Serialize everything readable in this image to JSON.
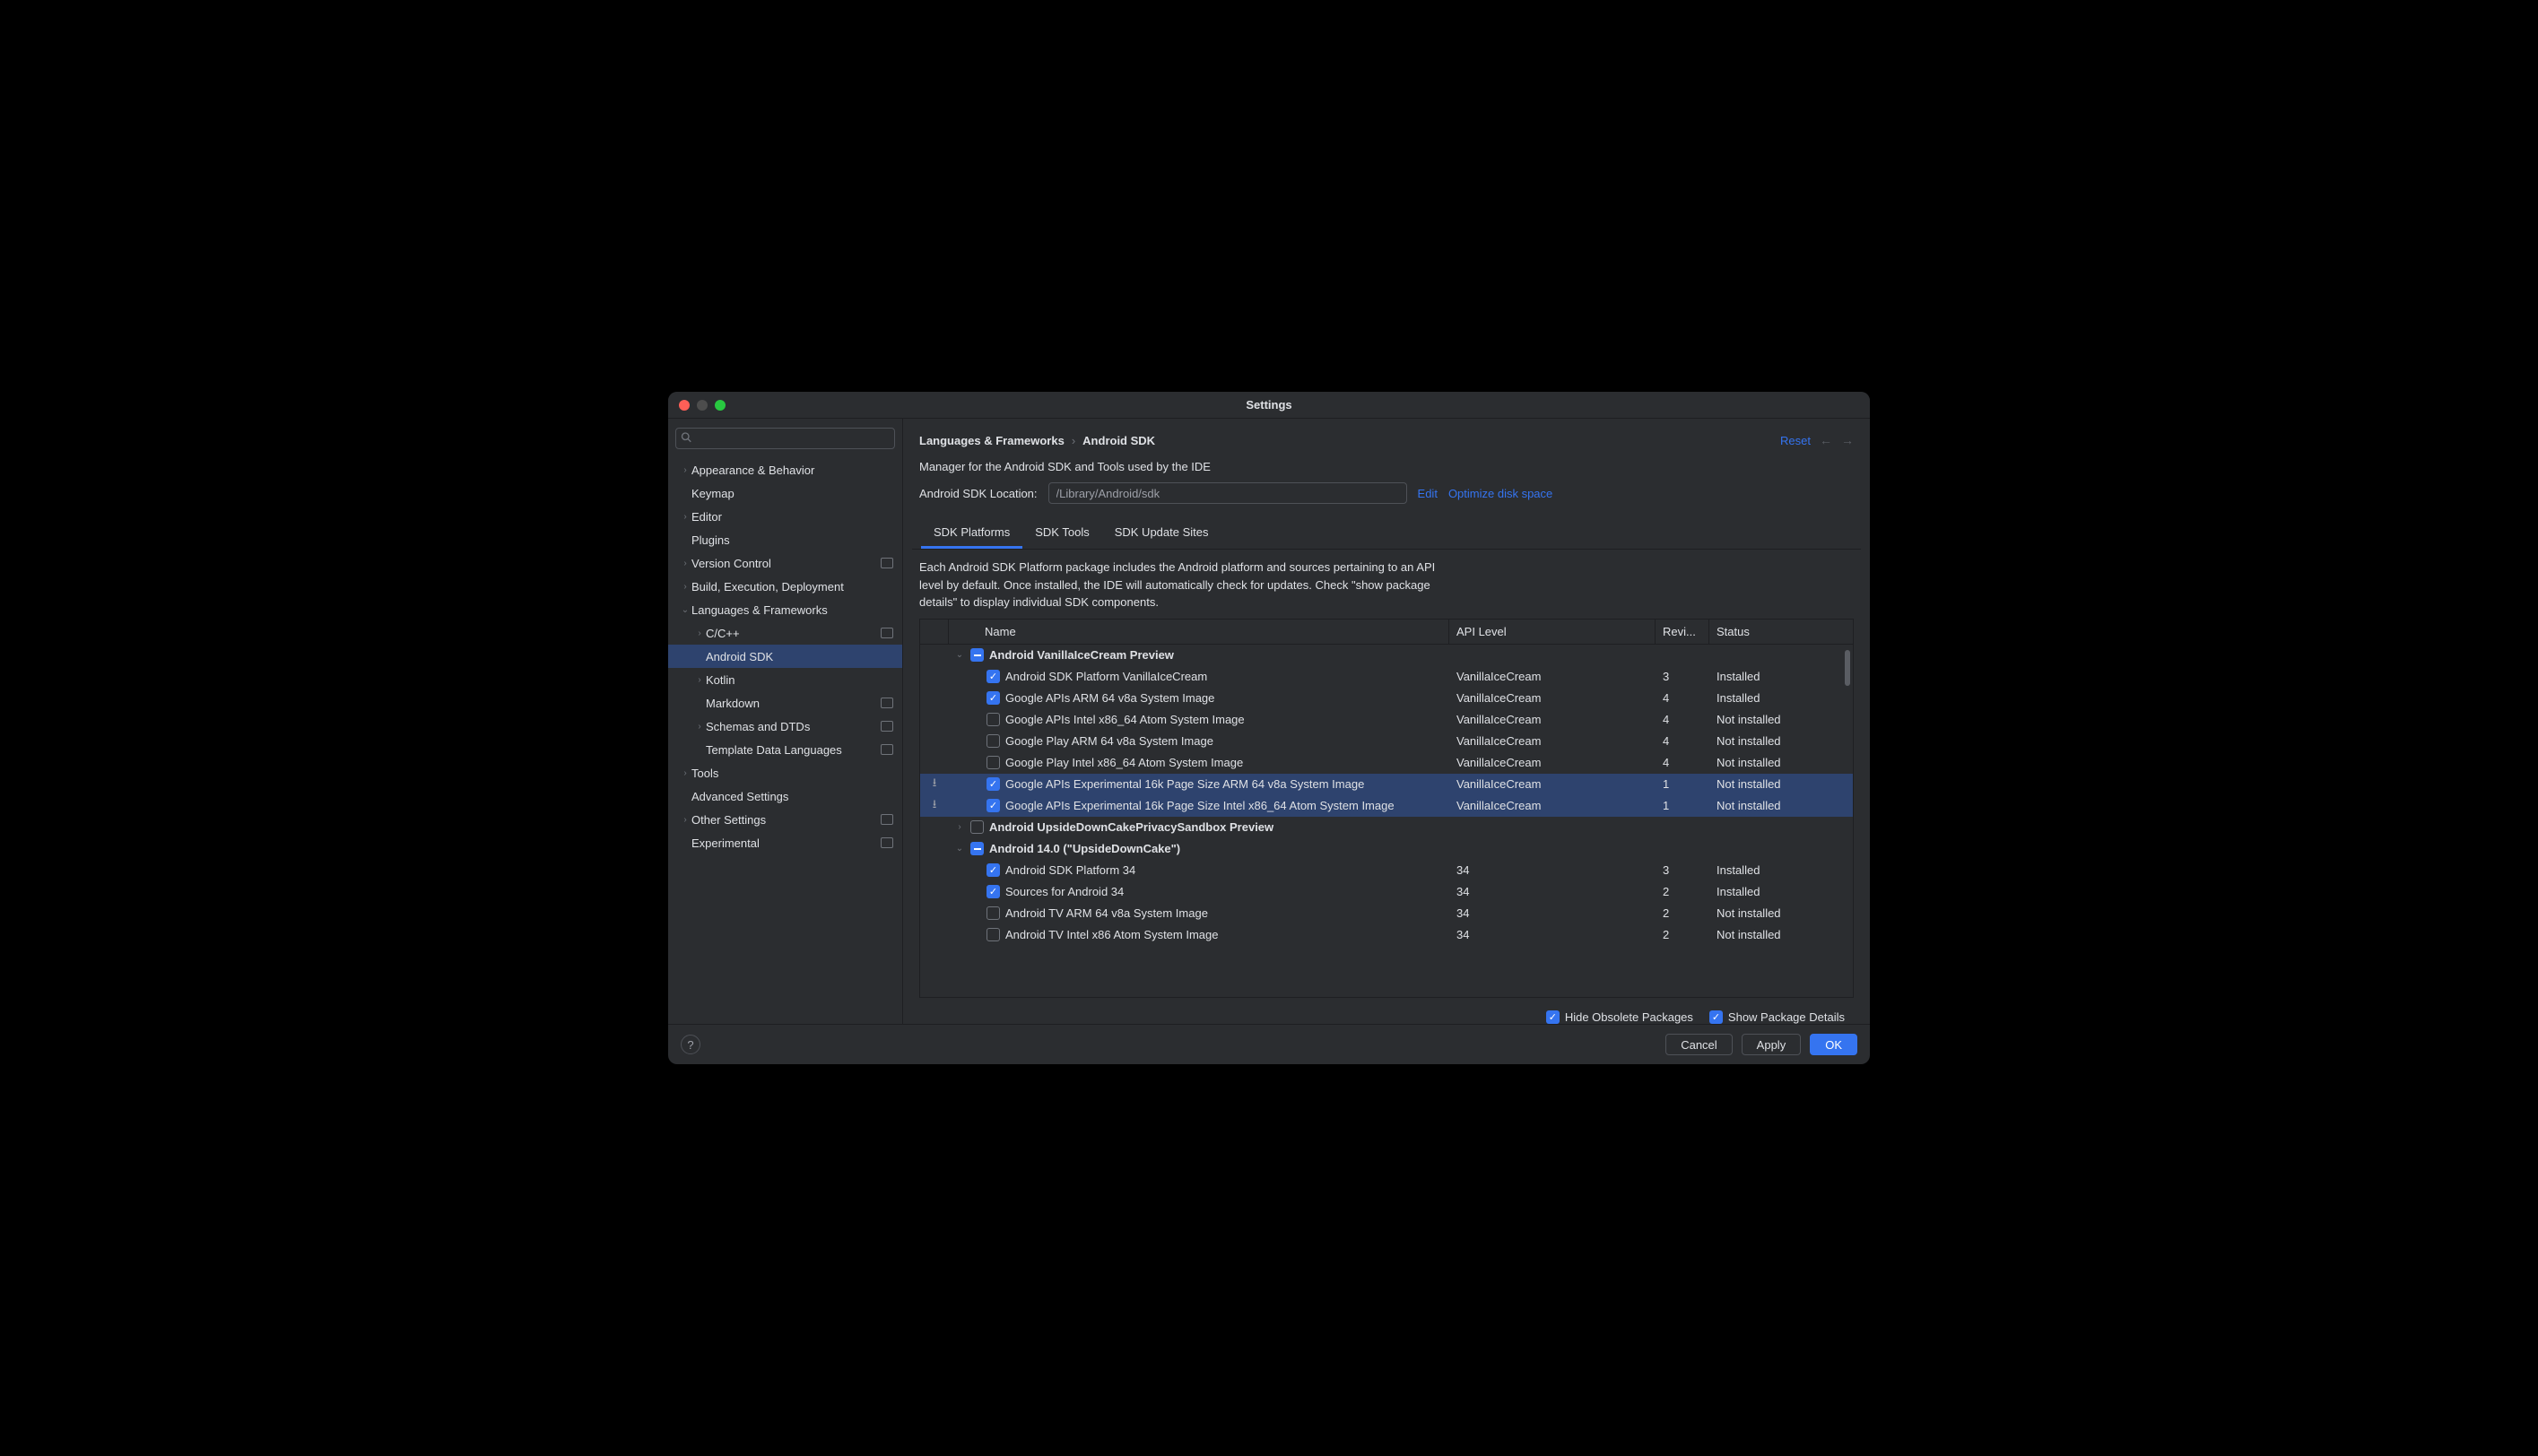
{
  "window": {
    "title": "Settings"
  },
  "search": {
    "placeholder": ""
  },
  "sidebar": {
    "items": [
      {
        "label": "Appearance & Behavior",
        "arrow": "right",
        "indent": 0,
        "badge": false
      },
      {
        "label": "Keymap",
        "arrow": "",
        "indent": 0,
        "badge": false
      },
      {
        "label": "Editor",
        "arrow": "right",
        "indent": 0,
        "badge": false
      },
      {
        "label": "Plugins",
        "arrow": "",
        "indent": 0,
        "badge": false
      },
      {
        "label": "Version Control",
        "arrow": "right",
        "indent": 0,
        "badge": true
      },
      {
        "label": "Build, Execution, Deployment",
        "arrow": "right",
        "indent": 0,
        "badge": false
      },
      {
        "label": "Languages & Frameworks",
        "arrow": "down",
        "indent": 0,
        "badge": false
      },
      {
        "label": "C/C++",
        "arrow": "right",
        "indent": 1,
        "badge": true
      },
      {
        "label": "Android SDK",
        "arrow": "",
        "indent": 1,
        "badge": false,
        "selected": true
      },
      {
        "label": "Kotlin",
        "arrow": "right",
        "indent": 1,
        "badge": false
      },
      {
        "label": "Markdown",
        "arrow": "",
        "indent": 1,
        "badge": true
      },
      {
        "label": "Schemas and DTDs",
        "arrow": "right",
        "indent": 1,
        "badge": true
      },
      {
        "label": "Template Data Languages",
        "arrow": "",
        "indent": 1,
        "badge": true
      },
      {
        "label": "Tools",
        "arrow": "right",
        "indent": 0,
        "badge": false
      },
      {
        "label": "Advanced Settings",
        "arrow": "",
        "indent": 0,
        "badge": false
      },
      {
        "label": "Other Settings",
        "arrow": "right",
        "indent": 0,
        "badge": true
      },
      {
        "label": "Experimental",
        "arrow": "",
        "indent": 0,
        "badge": true
      }
    ]
  },
  "breadcrumb": {
    "parent": "Languages & Frameworks",
    "current": "Android SDK"
  },
  "reset": "Reset",
  "subtitle": "Manager for the Android SDK and Tools used by the IDE",
  "location": {
    "label": "Android SDK Location:",
    "value": "/Library/Android/sdk",
    "edit": "Edit",
    "optimize": "Optimize disk space"
  },
  "tabs": [
    {
      "label": "SDK Platforms",
      "active": true
    },
    {
      "label": "SDK Tools",
      "active": false
    },
    {
      "label": "SDK Update Sites",
      "active": false
    }
  ],
  "note": "Each Android SDK Platform package includes the Android platform and sources pertaining to an API level by default. Once installed, the IDE will automatically check for updates. Check \"show package details\" to display individual SDK components.",
  "columns": {
    "name": "Name",
    "api": "API Level",
    "rev": "Revi...",
    "status": "Status"
  },
  "rows": [
    {
      "kind": "group",
      "arrow": "down",
      "check": "indet",
      "label": "Android VanillaIceCream Preview",
      "indent": 0
    },
    {
      "kind": "item",
      "check": "checked",
      "label": "Android SDK Platform VanillaIceCream",
      "api": "VanillaIceCream",
      "rev": "3",
      "status": "Installed",
      "indent": 1
    },
    {
      "kind": "item",
      "check": "checked",
      "label": "Google APIs ARM 64 v8a System Image",
      "api": "VanillaIceCream",
      "rev": "4",
      "status": "Installed",
      "indent": 1
    },
    {
      "kind": "item",
      "check": "empty",
      "label": "Google APIs Intel x86_64 Atom System Image",
      "api": "VanillaIceCream",
      "rev": "4",
      "status": "Not installed",
      "indent": 1
    },
    {
      "kind": "item",
      "check": "empty",
      "label": "Google Play ARM 64 v8a System Image",
      "api": "VanillaIceCream",
      "rev": "4",
      "status": "Not installed",
      "indent": 1
    },
    {
      "kind": "item",
      "check": "empty",
      "label": "Google Play Intel x86_64 Atom System Image",
      "api": "VanillaIceCream",
      "rev": "4",
      "status": "Not installed",
      "indent": 1
    },
    {
      "kind": "item",
      "check": "checked",
      "label": "Google APIs Experimental 16k Page Size ARM 64 v8a System Image",
      "api": "VanillaIceCream",
      "rev": "1",
      "status": "Not installed",
      "indent": 1,
      "selected": true,
      "dl": true
    },
    {
      "kind": "item",
      "check": "checked",
      "label": "Google APIs Experimental 16k Page Size Intel x86_64 Atom System Image",
      "api": "VanillaIceCream",
      "rev": "1",
      "status": "Not installed",
      "indent": 1,
      "selected": true,
      "dl": true
    },
    {
      "kind": "group",
      "arrow": "right",
      "check": "empty",
      "label": "Android UpsideDownCakePrivacySandbox Preview",
      "indent": 0
    },
    {
      "kind": "group",
      "arrow": "down",
      "check": "indet",
      "label": "Android 14.0 (\"UpsideDownCake\")",
      "indent": 0
    },
    {
      "kind": "item",
      "check": "checked",
      "label": "Android SDK Platform 34",
      "api": "34",
      "rev": "3",
      "status": "Installed",
      "indent": 1
    },
    {
      "kind": "item",
      "check": "checked",
      "label": "Sources for Android 34",
      "api": "34",
      "rev": "2",
      "status": "Installed",
      "indent": 1
    },
    {
      "kind": "item",
      "check": "empty",
      "label": "Android TV ARM 64 v8a System Image",
      "api": "34",
      "rev": "2",
      "status": "Not installed",
      "indent": 1
    },
    {
      "kind": "item",
      "check": "empty",
      "label": "Android TV Intel x86 Atom System Image",
      "api": "34",
      "rev": "2",
      "status": "Not installed",
      "indent": 1
    }
  ],
  "options": {
    "hide": "Hide Obsolete Packages",
    "show": "Show Package Details"
  },
  "buttons": {
    "cancel": "Cancel",
    "apply": "Apply",
    "ok": "OK"
  }
}
